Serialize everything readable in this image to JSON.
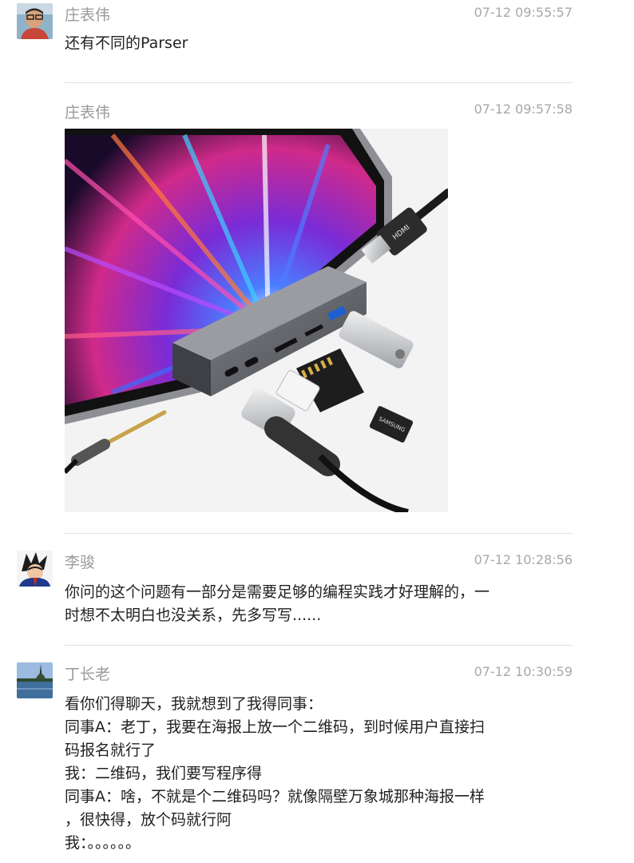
{
  "messages": [
    {
      "sender": "庄表伟",
      "time": "07-12 09:55:57",
      "lines": [
        "还有不同的Parser"
      ]
    },
    {
      "sender": "庄表伟",
      "time": "07-12 09:57:58",
      "image": "usb-c-hub-product-photo"
    },
    {
      "sender": "李骏",
      "time": "07-12 10:28:56",
      "lines": [
        "你问的这个问题有一部分是需要足够的编程实践才好理解的，一",
        "时想不太明白也没关系，先多写写......"
      ]
    },
    {
      "sender": "丁长老",
      "time": "07-12 10:30:59",
      "lines": [
        "看你们得聊天，我就想到了我得同事：",
        "同事A：老丁，我要在海报上放一个二维码，到时候用户直接扫",
        "码报名就行了",
        "我：二维码，我们要写程序得",
        "同事A：啥，不就是个二维码吗？就像隔壁万象城那种海报一样",
        "，很快得，放个码就行阿",
        "我：。。。。。。"
      ]
    }
  ],
  "image_labels": {
    "hdmi": "HDMI",
    "samsung": "SAMSUNG"
  }
}
